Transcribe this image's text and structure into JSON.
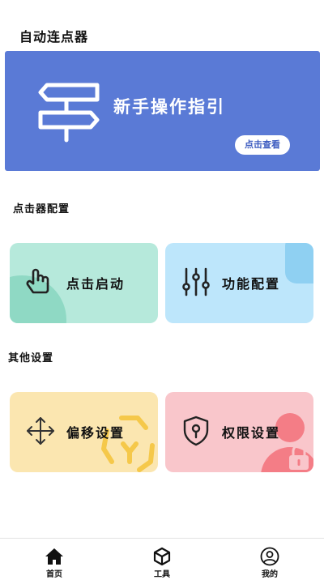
{
  "header": {
    "title": "自动连点器"
  },
  "banner": {
    "title": "新手操作指引",
    "button_label": "点击查看",
    "icon": "signpost-icon"
  },
  "sections": {
    "clicker_config": "点击器配置",
    "other_settings": "其他设置"
  },
  "cards": {
    "click_start": {
      "label": "点击启动",
      "icon": "tap-hand-icon"
    },
    "function_config": {
      "label": "功能配置",
      "icon": "sliders-icon"
    },
    "offset_settings": {
      "label": "偏移设置",
      "icon": "move-arrows-icon"
    },
    "permission_settings": {
      "label": "权限设置",
      "icon": "shield-lock-icon"
    }
  },
  "nav": {
    "items": [
      {
        "label": "首页",
        "icon": "home-icon"
      },
      {
        "label": "工具",
        "icon": "cube-icon"
      },
      {
        "label": "我的",
        "icon": "user-icon"
      }
    ]
  },
  "colors": {
    "banner": "#5a7ad6",
    "card_click": "#b6e9db",
    "card_function": "#bde6fb",
    "card_offset": "#fbe6b0",
    "card_permission": "#f9c6cb"
  }
}
